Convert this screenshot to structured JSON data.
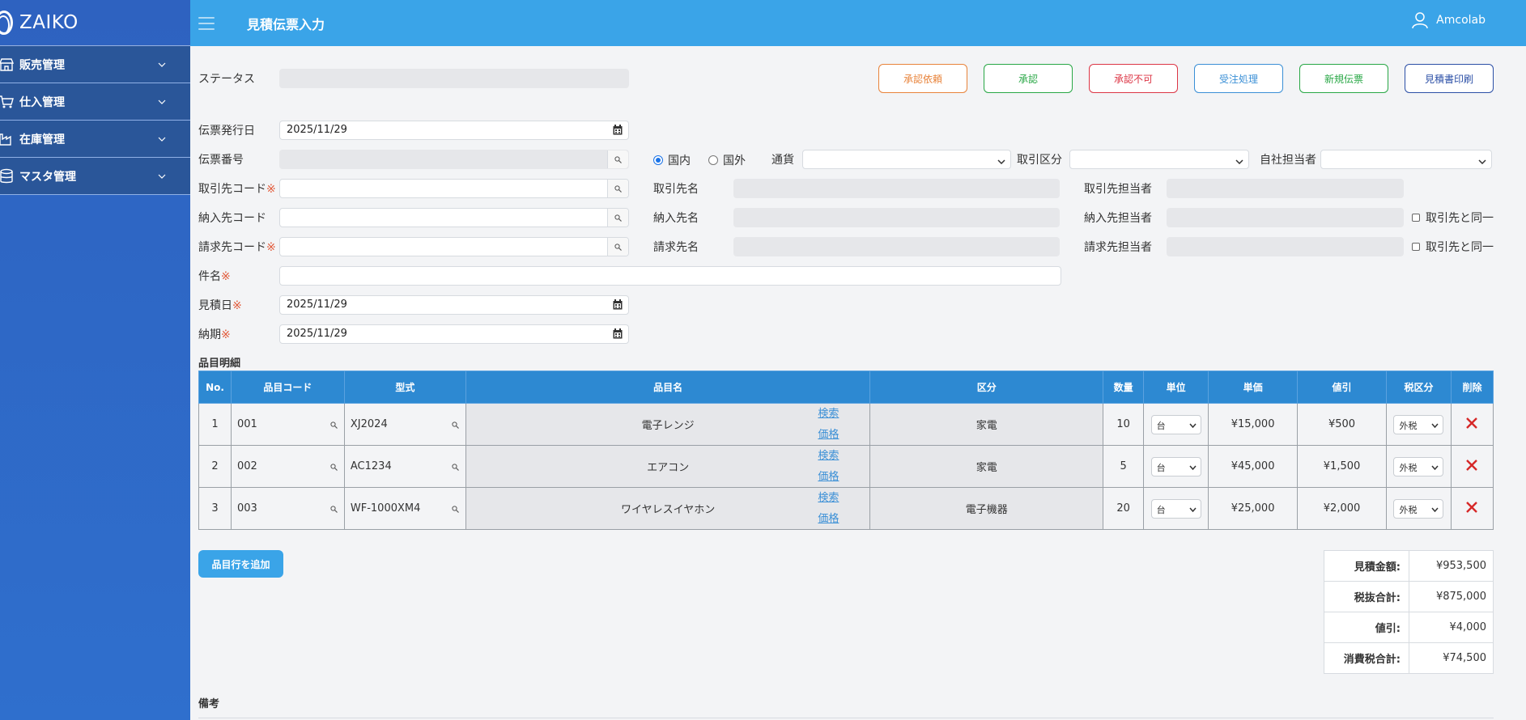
{
  "sidebar": {
    "brand": "ZAIKO",
    "items": [
      {
        "label": "販売管理",
        "icon": "store-icon"
      },
      {
        "label": "仕入管理",
        "icon": "cart-icon"
      },
      {
        "label": "在庫管理",
        "icon": "factory-icon"
      },
      {
        "label": "マスタ管理",
        "icon": "database-icon"
      }
    ]
  },
  "header": {
    "title": "見積伝票入力",
    "user": "Amcolab"
  },
  "form": {
    "status_label": "ステータス",
    "status_value": "",
    "issue_date_label": "伝票発行日",
    "issue_date": "2025/11/29",
    "slip_no_label": "伝票番号",
    "domestic_label": "国内",
    "foreign_label": "国外",
    "currency_label": "通貨",
    "deal_type_label": "取引区分",
    "staff_label": "自社担当者",
    "client_code_label": "取引先コード",
    "client_name_label": "取引先名",
    "client_person_label": "取引先担当者",
    "delivery_code_label": "納入先コード",
    "delivery_name_label": "納入先名",
    "delivery_person_label": "納入先担当者",
    "same_as_client_label": "取引先と同一",
    "billing_code_label": "請求先コード",
    "billing_name_label": "請求先名",
    "billing_person_label": "請求先担当者",
    "subject_label": "件名",
    "estimate_date_label": "見積日",
    "estimate_date": "2025/11/29",
    "due_date_label": "納期",
    "due_date": "2025/11/29",
    "required_mark": "※"
  },
  "actions": {
    "request_approval": "承認依頼",
    "approve": "承認",
    "reject": "承認不可",
    "order_process": "受注処理",
    "new_slip": "新規伝票",
    "print_estimate": "見積書印刷"
  },
  "items_section": {
    "title": "品目明細",
    "columns": [
      "No.",
      "品目コード",
      "型式",
      "品目名",
      "区分",
      "数量",
      "単位",
      "単価",
      "値引",
      "税区分",
      "削除"
    ],
    "search_link": "検索",
    "price_link": "価格",
    "rows": [
      {
        "no": "1",
        "code": "001",
        "model": "XJ2024",
        "name": "電子レンジ",
        "category": "家電",
        "qty": "10",
        "unit": "台",
        "price": "¥15,000",
        "discount": "¥500",
        "tax": "外税"
      },
      {
        "no": "2",
        "code": "002",
        "model": "AC1234",
        "name": "エアコン",
        "category": "家電",
        "qty": "5",
        "unit": "台",
        "price": "¥45,000",
        "discount": "¥1,500",
        "tax": "外税"
      },
      {
        "no": "3",
        "code": "003",
        "model": "WF-1000XM4",
        "name": "ワイヤレスイヤホン",
        "category": "電子機器",
        "qty": "20",
        "unit": "台",
        "price": "¥25,000",
        "discount": "¥2,000",
        "tax": "外税"
      }
    ],
    "add_row": "品目行を追加"
  },
  "summary": [
    {
      "label": "見積金額:",
      "value": "¥953,500"
    },
    {
      "label": "税抜合計:",
      "value": "¥875,000"
    },
    {
      "label": "値引:",
      "value": "¥4,000"
    },
    {
      "label": "消費税合計:",
      "value": "¥74,500"
    }
  ],
  "notes_label": "備考",
  "colors": {
    "header": "#3aa4e8",
    "sidebar": "#2e62c0",
    "table_header": "#2d89d2",
    "btn_orange": "#e8833a",
    "btn_green": "#28a745",
    "btn_red": "#dc3545",
    "btn_blue": "#3a8fd6",
    "btn_navy": "#2b4fa6"
  }
}
